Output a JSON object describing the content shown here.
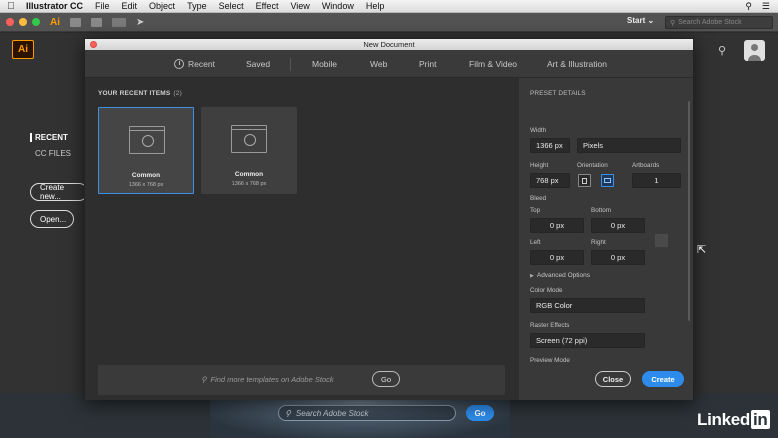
{
  "menubar": {
    "app_name": "Illustrator CC",
    "items": [
      "File",
      "Edit",
      "Object",
      "Type",
      "Select",
      "Effect",
      "View",
      "Window",
      "Help"
    ]
  },
  "toolbar": {
    "app_mark": "Ai",
    "start_label": "Start",
    "stock_placeholder": "Search Adobe Stock"
  },
  "workspace": {
    "logo": "Ai",
    "recent_label": "RECENT",
    "cc_files_label": "CC FILES",
    "create_new_label": "Create new...",
    "open_label": "Open...",
    "banner_search_placeholder": "Search Adobe Stock",
    "banner_go_label": "Go",
    "watermark": "Linked",
    "watermark_in": "in"
  },
  "dialog": {
    "title": "New Document",
    "tabs": [
      "Recent",
      "Saved",
      "Mobile",
      "Web",
      "Print",
      "Film & Video",
      "Art & Illustration"
    ],
    "recent_items_label": "YOUR RECENT ITEMS",
    "recent_items_count": "(2)",
    "recent_items": [
      {
        "name": "Common",
        "dims": "1366 x 768 px"
      },
      {
        "name": "Common",
        "dims": "1366 x 768 px"
      }
    ],
    "template_search_placeholder": "Find more templates on Adobe Stock",
    "template_go_label": "Go"
  },
  "preset": {
    "title": "PRESET DETAILS",
    "width_label": "Width",
    "width_value": "1366 px",
    "units_value": "Pixels",
    "height_label": "Height",
    "height_value": "768 px",
    "orientation_label": "Orientation",
    "artboards_label": "Artboards",
    "artboards_value": "1",
    "bleed_label": "Bleed",
    "top_label": "Top",
    "top_value": "0 px",
    "bottom_label": "Bottom",
    "bottom_value": "0 px",
    "left_label": "Left",
    "left_value": "0 px",
    "right_label": "Right",
    "right_value": "0 px",
    "advanced_label": "Advanced Options",
    "color_mode_label": "Color Mode",
    "color_mode_value": "RGB Color",
    "raster_label": "Raster Effects",
    "raster_value": "Screen (72 ppi)",
    "preview_label": "Preview Mode",
    "close_label": "Close",
    "create_label": "Create"
  },
  "colors": {
    "accent": "#2d8ceb",
    "dialog_bg": "#2e2e2e",
    "panel_bg": "#393939",
    "ai_orange": "#ff9a00"
  }
}
